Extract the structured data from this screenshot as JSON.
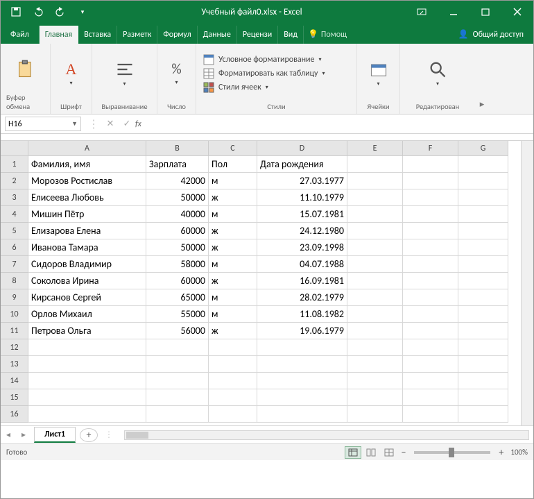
{
  "app": {
    "title": "Учебный файл0.xlsx - Excel"
  },
  "tabs": {
    "file": "Файл",
    "items": [
      "Главная",
      "Вставка",
      "Разметк",
      "Формул",
      "Данные",
      "Рецензи",
      "Вид"
    ],
    "active": "Главная",
    "tellme": "Помощ",
    "share": "Общий доступ"
  },
  "ribbon": {
    "clipboard": {
      "label": "Буфер обмена",
      "btn": ""
    },
    "font": {
      "label": "Шрифт"
    },
    "align": {
      "label": "Выравнивание"
    },
    "number": {
      "label": "Число"
    },
    "styles": {
      "label": "Стили",
      "cond": "Условное форматирование",
      "fmt_table": "Форматировать как таблицу",
      "cell_styles": "Стили ячеек"
    },
    "cells": {
      "label": "Ячейки"
    },
    "editing": {
      "label": "Редактирован"
    }
  },
  "namebox": "H16",
  "columns": [
    "A",
    "B",
    "C",
    "D",
    "E",
    "F",
    "G"
  ],
  "row_numbers": [
    1,
    2,
    3,
    4,
    5,
    6,
    7,
    8,
    9,
    10,
    11,
    12,
    13,
    14,
    15,
    16
  ],
  "headers": {
    "A": "Фамилия, имя",
    "B": "Зарплата",
    "C": "Пол",
    "D": "Дата рождения"
  },
  "data_rows": [
    {
      "A": "Морозов Ростислав",
      "B": "42000",
      "C": "м",
      "D": "27.03.1977"
    },
    {
      "A": "Елисеева Любовь",
      "B": "50000",
      "C": "ж",
      "D": "11.10.1979"
    },
    {
      "A": "Мишин Пётр",
      "B": "40000",
      "C": "м",
      "D": "15.07.1981"
    },
    {
      "A": "Елизарова Елена",
      "B": "60000",
      "C": "ж",
      "D": "24.12.1980"
    },
    {
      "A": "Иванова Тамара",
      "B": "50000",
      "C": "ж",
      "D": "23.09.1998"
    },
    {
      "A": "Сидоров Владимир",
      "B": "58000",
      "C": "м",
      "D": "04.07.1988"
    },
    {
      "A": "Соколова Ирина",
      "B": "60000",
      "C": "ж",
      "D": "16.09.1981"
    },
    {
      "A": "Кирсанов Сергей",
      "B": "65000",
      "C": "м",
      "D": "28.02.1979"
    },
    {
      "A": "Орлов Михаил",
      "B": "55000",
      "C": "м",
      "D": "11.08.1982"
    },
    {
      "A": "Петрова Ольга",
      "B": "56000",
      "C": "ж",
      "D": "19.06.1979"
    }
  ],
  "sheet": {
    "name": "Лист1"
  },
  "status": {
    "ready": "Готово",
    "zoom": "100%"
  }
}
